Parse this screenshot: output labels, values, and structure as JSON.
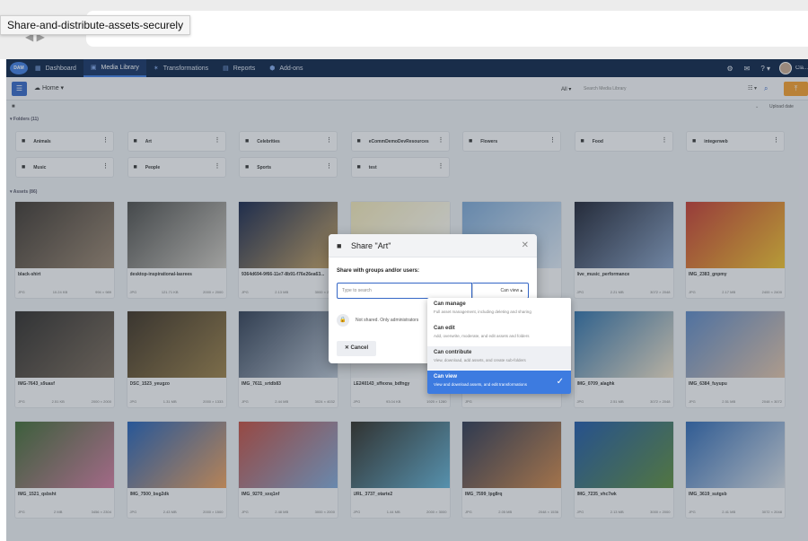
{
  "tooltip": "Share-and-distribute-assets-securely",
  "nav": {
    "logo": "DAM",
    "items": [
      {
        "label": "Dashboard",
        "icon": "▦"
      },
      {
        "label": "Media Library",
        "icon": "▣"
      },
      {
        "label": "Transformations",
        "icon": "✶"
      },
      {
        "label": "Reports",
        "icon": "▤"
      },
      {
        "label": "Add-ons",
        "icon": "⬢"
      }
    ],
    "user_name": "Cla..."
  },
  "toolbar": {
    "menu": "☰",
    "home": "☁  Home  ▾",
    "scope": "All ▾",
    "search_placeholder": "Search Media Library",
    "view_toggle": "☷ ▾",
    "search_icon": "⌕",
    "upload": "⤒"
  },
  "subbar": {
    "sort": "Upload date"
  },
  "folders_header": "▾ Folders (11)",
  "assets_header": "▾ Assets (86)",
  "folders": [
    "Animals",
    "Art",
    "Celebrities",
    "eCommDemoDevResources",
    "Flowers",
    "Food",
    "integerweb",
    "Music",
    "People",
    "Sports",
    "test"
  ],
  "assets": [
    {
      "name": "black-shirt",
      "type": "JPG",
      "size": "10.24 KB",
      "dims": "994 × 989",
      "c1": "#3b342e",
      "c2": "#9b8670"
    },
    {
      "name": "desktop-inspirational-lasrees",
      "type": "JPG",
      "size": "121.71 KB",
      "dims": "2000 × 2000",
      "c1": "#4a4a48",
      "c2": "#cfcac2"
    },
    {
      "name": "9364d694-9f66-11e7-8b91-f76e26ea63...",
      "type": "JPG",
      "size": "2.13 MB",
      "dims": "3000 × 2000",
      "c1": "#14234a",
      "c2": "#caa462"
    },
    {
      "name": "",
      "type": "",
      "size": "",
      "dims": "",
      "c1": "#f3e7b6",
      "c2": "#ffffff"
    },
    {
      "name": "",
      "type": "",
      "size": "",
      "dims": "",
      "c1": "#7aa6d4",
      "c2": "#dfe9f4"
    },
    {
      "name": "live_music_performance",
      "type": "JPG",
      "size": "2.21 MB",
      "dims": "3072 × 2048",
      "c1": "#1c2030",
      "c2": "#8aa3c8"
    },
    {
      "name": "IMG_2383_gnpmy",
      "type": "JPG",
      "size": "2.17 MB",
      "dims": "2400 × 2400",
      "c1": "#c4372f",
      "c2": "#f1c32a"
    },
    {
      "name": "IMG-7643_s9uasf",
      "type": "JPG",
      "size": "2.51 KB",
      "dims": "2000 × 2000",
      "c1": "#2d2a28",
      "c2": "#7b6b5a"
    },
    {
      "name": "DSC_1523_yeugzo",
      "type": "JPG",
      "size": "1.31 MB",
      "dims": "2000 × 1333",
      "c1": "#3a2e20",
      "c2": "#9b7f46"
    },
    {
      "name": "IMG_7611_srtdb83",
      "type": "JPG",
      "size": "2.44 MB",
      "dims": "3024 × 4032",
      "c1": "#2f3c52",
      "c2": "#b9c4d2"
    },
    {
      "name": "LE240143_sffexna_bdfngy",
      "type": "JPG",
      "size": "93.04 KB",
      "dims": "1920 × 1280",
      "c1": "#e3e6ea",
      "c2": "#ffffff"
    },
    {
      "name": "",
      "type": "JPG",
      "size": "",
      "dims": "",
      "c1": "#c9d4de",
      "c2": "#eef1f4"
    },
    {
      "name": "IMG_0709_alaghk",
      "type": "JPG",
      "size": "2.51 MB",
      "dims": "3072 × 2048",
      "c1": "#2d6fa8",
      "c2": "#f1e2c8"
    },
    {
      "name": "IMG_6384_fuyupu",
      "type": "JPG",
      "size": "2.51 MB",
      "dims": "2048 × 3072",
      "c1": "#5a86c4",
      "c2": "#e3c3a8"
    },
    {
      "name": "IMG_1521_qsbsht",
      "type": "JPG",
      "size": "2 MB",
      "dims": "3456 × 2304",
      "c1": "#3e6a32",
      "c2": "#d47aa0"
    },
    {
      "name": "IMG_7500_bsg2dk",
      "type": "JPG",
      "size": "2.43 MB",
      "dims": "2000 × 1500",
      "c1": "#1f5fb8",
      "c2": "#f0a05a"
    },
    {
      "name": "IMG_9270_sxq1nf",
      "type": "JPG",
      "size": "2.48 MB",
      "dims": "3000 × 2000",
      "c1": "#c24a3c",
      "c2": "#7fa8d8"
    },
    {
      "name": "URL_3737_otarte2",
      "type": "JPG",
      "size": "1.44 MB",
      "dims": "2000 × 3000",
      "c1": "#2d2a22",
      "c2": "#64b4d8"
    },
    {
      "name": "IMG_7599_lpg8rq",
      "type": "JPG",
      "size": "2.05 MB",
      "dims": "2048 × 1536",
      "c1": "#2a3550",
      "c2": "#d38848"
    },
    {
      "name": "IMG_7235_vhc7wk",
      "type": "JPG",
      "size": "2.13 MB",
      "dims": "3000 × 2000",
      "c1": "#1e57a8",
      "c2": "#5d8c3a"
    },
    {
      "name": "IMG_3619_sutgsb",
      "type": "JPG",
      "size": "2.41 MB",
      "dims": "3072 × 2048",
      "c1": "#2c66b2",
      "c2": "#d9dfe6"
    }
  ],
  "dialog": {
    "title": "Share \"Art\"",
    "close": "✕",
    "share_label": "Share with groups and/or users:",
    "input_placeholder": "Type to search",
    "permission": "Can view ▴",
    "not_shared": "Not shared. Only administrators",
    "cancel": "✕  Cancel"
  },
  "permissions": [
    {
      "title": "Can manage",
      "desc": "Full asset management, including deleting and sharing"
    },
    {
      "title": "Can edit",
      "desc": "Add, overwrite, moderate, and edit assets and folders"
    },
    {
      "title": "Can contribute",
      "desc": "View, download, add assets, and create sub-folders"
    },
    {
      "title": "Can view",
      "desc": "View and download assets, and edit transformations",
      "selected": true
    }
  ],
  "colors": {
    "nav_bg": "#0a2146",
    "accent": "#3d7be0",
    "upload": "#f59c2a"
  }
}
